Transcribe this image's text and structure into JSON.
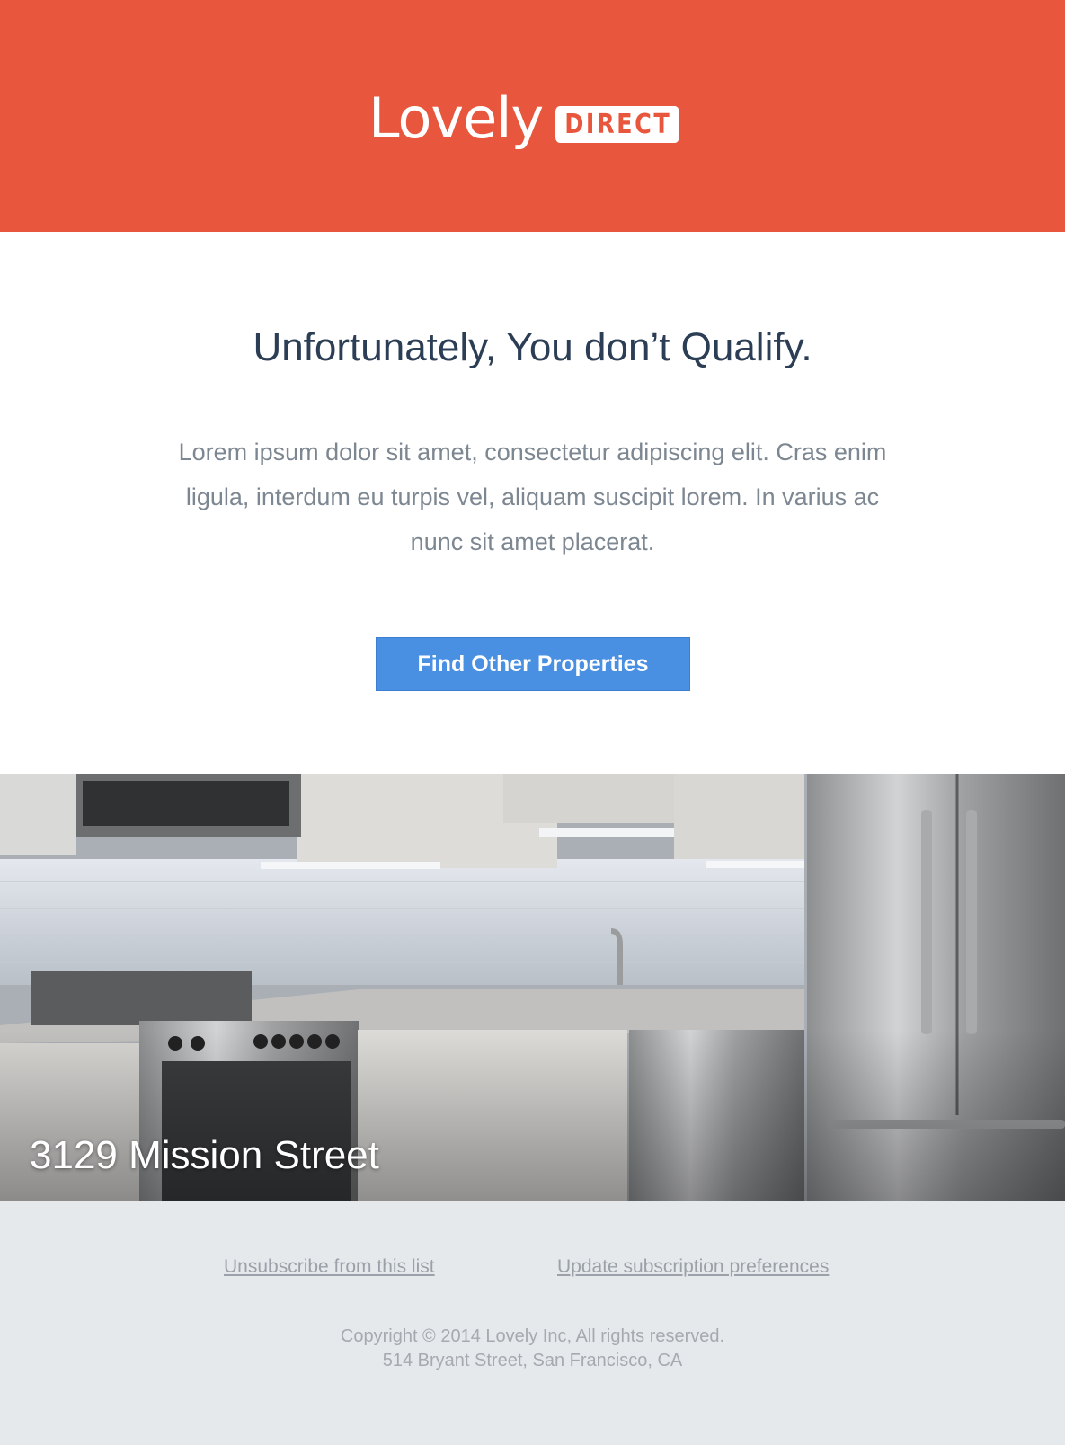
{
  "brand": {
    "logo_script": "Lovely",
    "logo_badge": "DIRECT",
    "header_color": "#e8573d"
  },
  "main": {
    "headline": "Unfortunately, You don’t Qualify.",
    "body": "Lorem ipsum dolor sit amet, consectetur adipiscing elit. Cras enim ligula, interdum eu turpis vel, aliquam suscipit lorem. In varius ac nunc sit amet placerat.",
    "cta_label": "Find Other Properties",
    "cta_color": "#4a90e2"
  },
  "property": {
    "address": "3129 Mission Street",
    "image_subject": "modern kitchen with white cabinets, stainless steel appliances"
  },
  "footer": {
    "unsubscribe_label": "Unsubscribe from this list",
    "preferences_label": "Update subscription preferences",
    "copyright": "Copyright © 2014 Lovely Inc, All rights reserved.",
    "address": "514 Bryant Street, San Francisco, CA"
  }
}
